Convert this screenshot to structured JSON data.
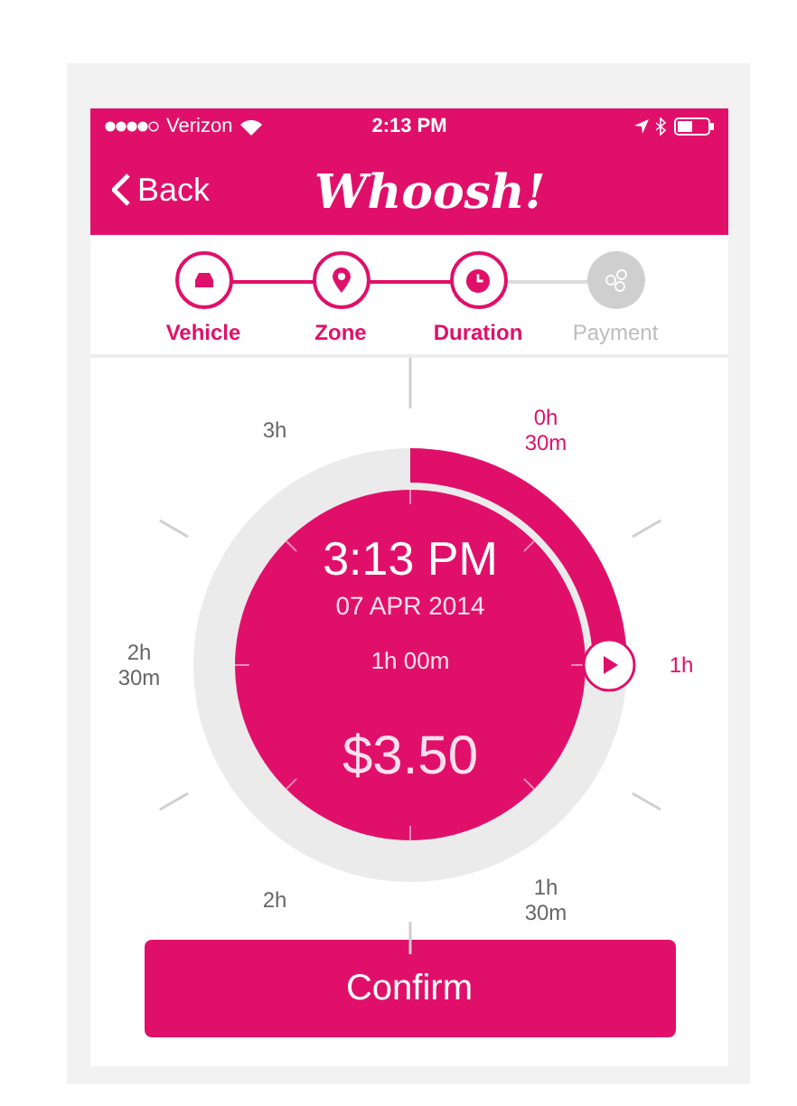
{
  "status_bar": {
    "carrier": "Verizon",
    "time": "2:13 PM"
  },
  "nav": {
    "back": "Back",
    "logo": "Whoosh!"
  },
  "steps": [
    {
      "label": "Vehicle",
      "kind": "car",
      "done": true
    },
    {
      "label": "Zone",
      "kind": "pin",
      "done": true
    },
    {
      "label": "Duration",
      "kind": "clock",
      "done": true
    },
    {
      "label": "Payment",
      "kind": "coins",
      "done": false
    }
  ],
  "dial": {
    "labels": [
      {
        "lines": [
          "0h",
          "30m"
        ],
        "active": true
      },
      {
        "lines": [
          "1h"
        ],
        "active": true
      },
      {
        "lines": [
          "1h",
          "30m"
        ],
        "active": false
      },
      {
        "lines": [
          "2h"
        ],
        "active": false
      },
      {
        "lines": [
          "2h",
          "30m"
        ],
        "active": false
      },
      {
        "lines": [
          "3h"
        ],
        "active": false
      }
    ],
    "time": "3:13 PM",
    "date": "07 APR 2014",
    "duration": "1h 00m",
    "price": "$3.50"
  },
  "confirm": "Confirm"
}
